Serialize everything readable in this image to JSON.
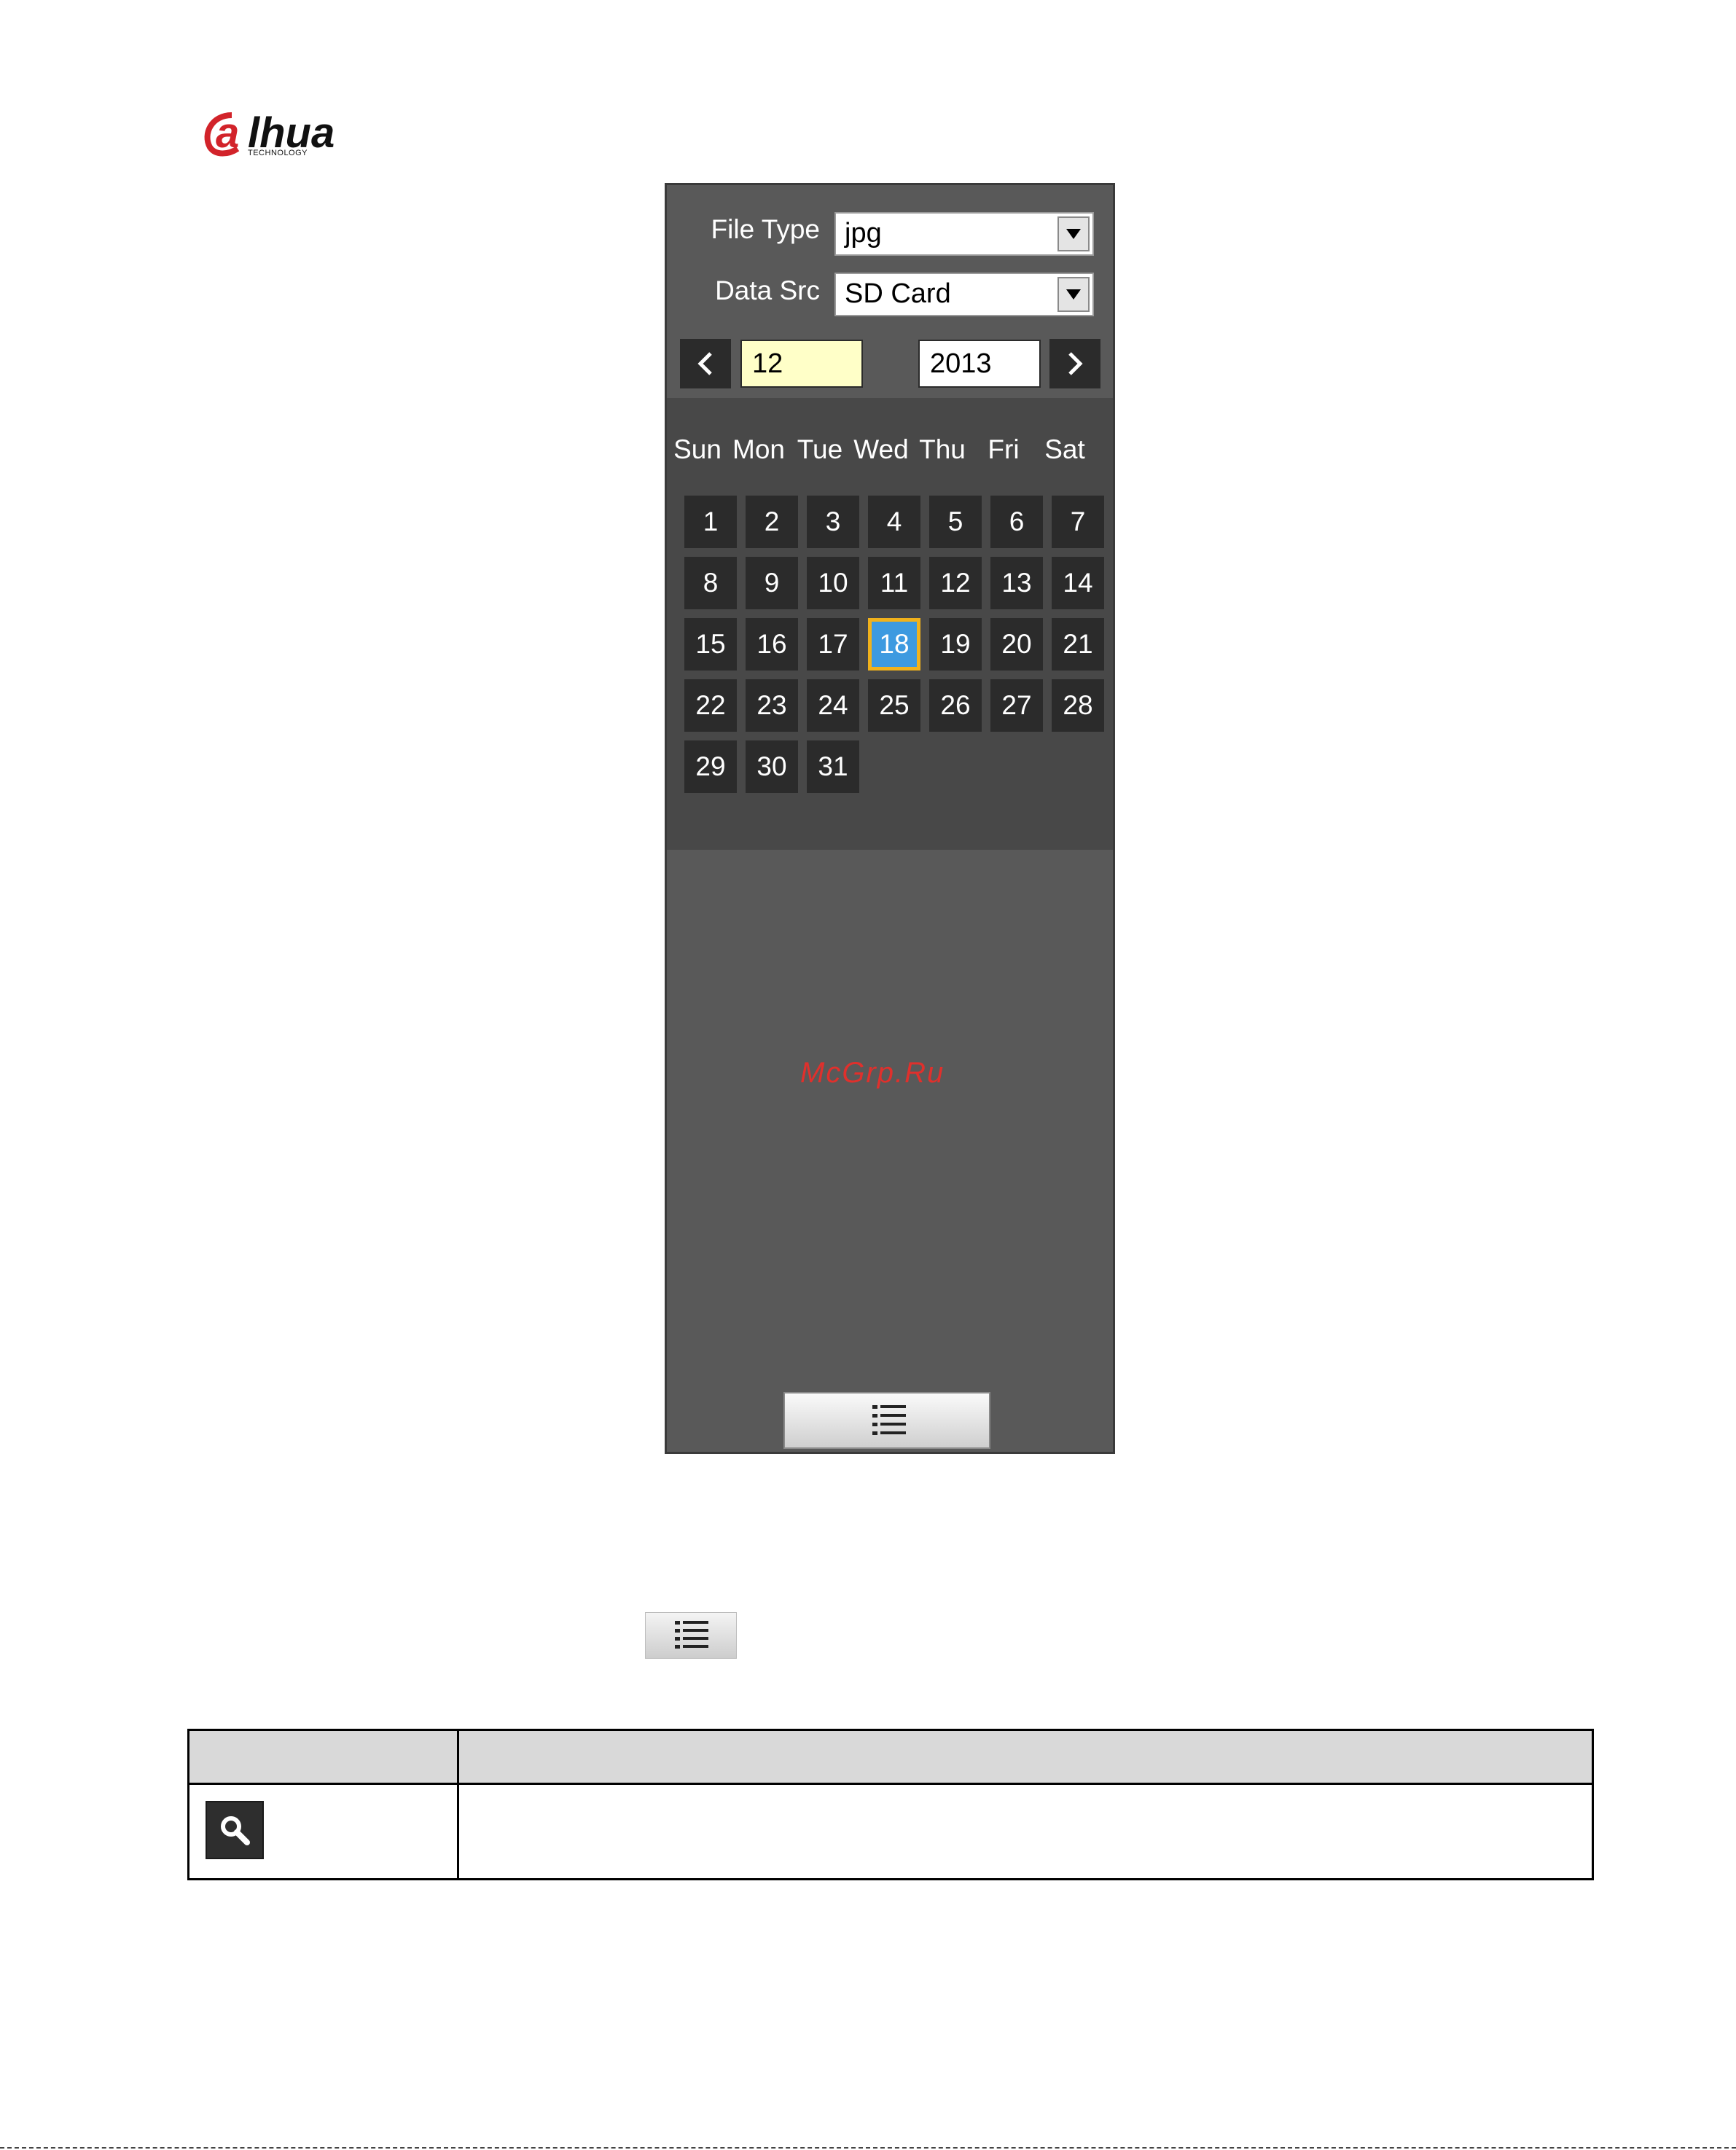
{
  "brand": {
    "name": "alhua",
    "tagline": "TECHNOLOGY"
  },
  "panel": {
    "file_type_label": "File Type",
    "file_type_value": "jpg",
    "data_src_label": "Data Src",
    "data_src_value": "SD Card",
    "month_value": "12",
    "year_value": "2013",
    "weekdays": [
      "Sun",
      "Mon",
      "Tue",
      "Wed",
      "Thu",
      "Fri",
      "Sat"
    ],
    "days": [
      "1",
      "2",
      "3",
      "4",
      "5",
      "6",
      "7",
      "8",
      "9",
      "10",
      "11",
      "12",
      "13",
      "14",
      "15",
      "16",
      "17",
      "18",
      "19",
      "20",
      "21",
      "22",
      "23",
      "24",
      "25",
      "26",
      "27",
      "28",
      "29",
      "30",
      "31"
    ],
    "selected_day": "18",
    "watermark": "McGrp.Ru",
    "icons": {
      "prev": "chevron-left-icon",
      "next": "chevron-right-icon",
      "dropdown": "triangle-down-icon",
      "list": "list-icon"
    }
  },
  "table": {
    "header": [
      "",
      ""
    ],
    "rows": [
      [
        "",
        ""
      ]
    ],
    "icon": "search-icon"
  },
  "colors": {
    "panel_bg": "#595959",
    "calendar_bg": "#484848",
    "day_bg": "#2b2b2b",
    "selected_bg": "#3d9ae0",
    "selected_border": "#f1b21c",
    "month_input_bg": "#ffffc8",
    "watermark": "#e0302c",
    "brand_red": "#d2232a"
  }
}
